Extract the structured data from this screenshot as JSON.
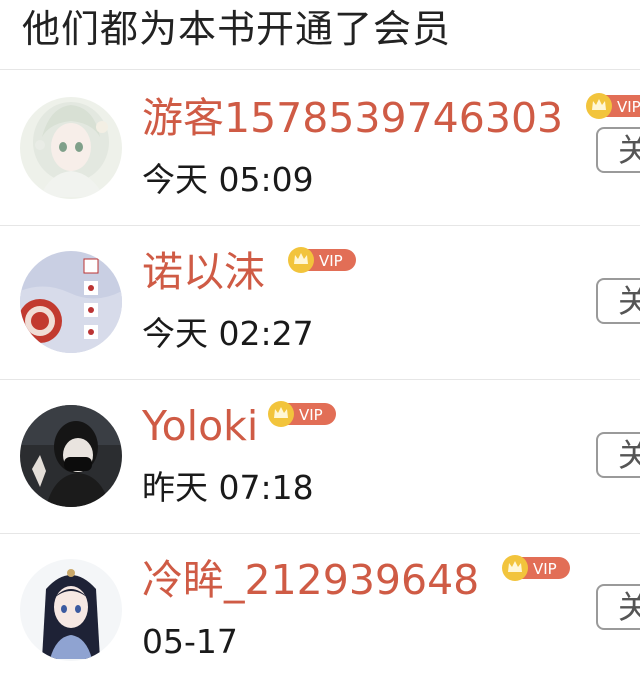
{
  "header": {
    "title": "他们都为本书开通了会员"
  },
  "members": [
    {
      "name": "游客1578539746303",
      "time": "今天 05:09",
      "vip_label": "VIP",
      "follow_label": "关注",
      "avatar": "anime-girl-white-hair-avatar"
    },
    {
      "name": "诺以沫",
      "time": "今天 02:27",
      "vip_label": "VIP",
      "follow_label": "关注",
      "avatar": "red-seal-painting-avatar"
    },
    {
      "name": "Yoloki",
      "time": "昨天 07:18",
      "vip_label": "VIP",
      "follow_label": "关注",
      "avatar": "masked-person-photo-avatar"
    },
    {
      "name": "冷眸_212939648",
      "time": "05-17",
      "vip_label": "VIP",
      "follow_label": "关注",
      "avatar": "anime-girl-dark-hair-avatar"
    }
  ],
  "colors": {
    "name": "#cf5b45",
    "vip_badge": "#e26e56",
    "crown": "#f2c43c",
    "divider": "#e6e6e6"
  }
}
